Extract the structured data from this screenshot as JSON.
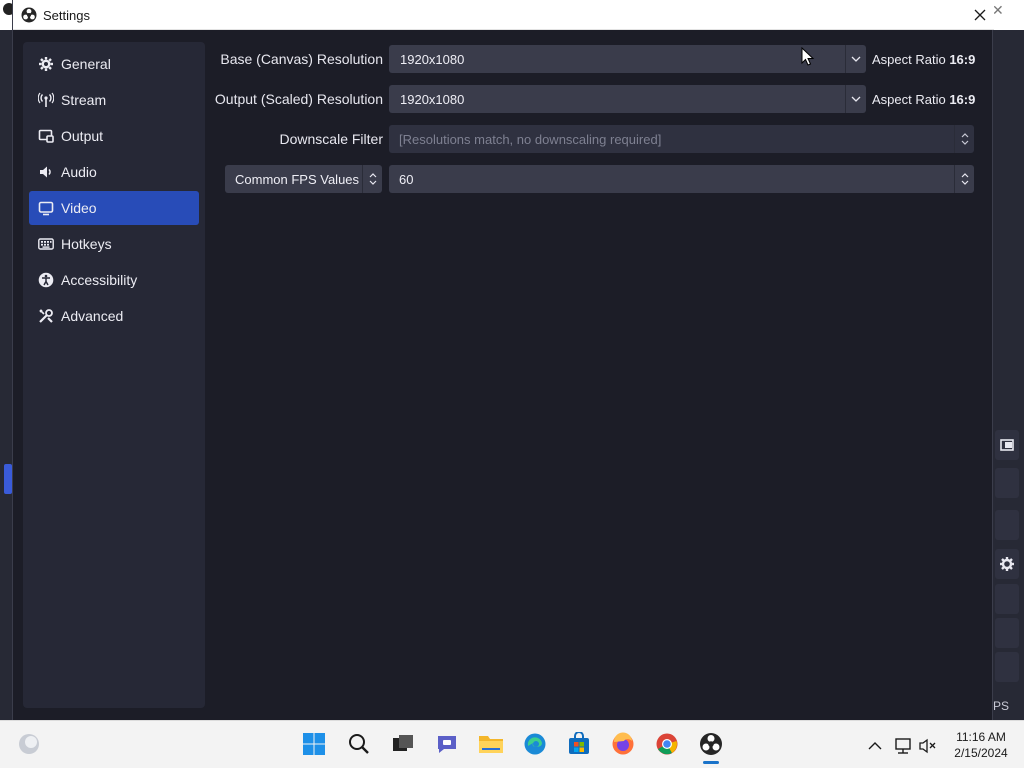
{
  "window": {
    "title": "Settings"
  },
  "sidebar": {
    "items": [
      {
        "label": "General",
        "icon": "gear-icon"
      },
      {
        "label": "Stream",
        "icon": "antenna-icon"
      },
      {
        "label": "Output",
        "icon": "output-icon"
      },
      {
        "label": "Audio",
        "icon": "speaker-icon"
      },
      {
        "label": "Video",
        "icon": "monitor-icon",
        "active": true
      },
      {
        "label": "Hotkeys",
        "icon": "keyboard-icon"
      },
      {
        "label": "Accessibility",
        "icon": "accessibility-icon"
      },
      {
        "label": "Advanced",
        "icon": "tools-icon"
      }
    ]
  },
  "video": {
    "base_label": "Base (Canvas) Resolution",
    "base_value": "1920x1080",
    "base_aspect_prefix": "Aspect Ratio",
    "base_aspect_value": "16:9",
    "output_label": "Output (Scaled) Resolution",
    "output_value": "1920x1080",
    "output_aspect_prefix": "Aspect Ratio",
    "output_aspect_value": "16:9",
    "downscale_label": "Downscale Filter",
    "downscale_value": "[Resolutions match, no downscaling required]",
    "fps_type_label": "Common FPS Values",
    "fps_value": "60"
  },
  "background": {
    "fps_fragment": "PS"
  },
  "taskbar": {
    "time": "11:16 AM",
    "date": "2/15/2024"
  },
  "colors": {
    "accent": "#284cb8",
    "dialog_bg": "#1c1d27",
    "sidebar_bg": "#262836",
    "field_bg": "#3a3c4b"
  }
}
